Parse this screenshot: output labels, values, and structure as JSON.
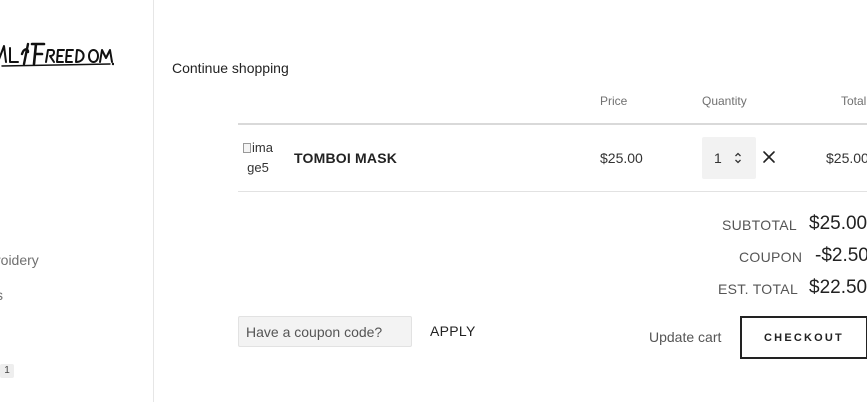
{
  "sidebar": {
    "logo_text": "RIDE IS FREEDOM",
    "nav_items": [
      {
        "label": "roidery"
      },
      {
        "label": "s"
      }
    ],
    "cart_count": "1"
  },
  "main": {
    "continue_label": "Continue shopping",
    "headers": {
      "price": "Price",
      "quantity": "Quantity",
      "total": "Total"
    },
    "items": [
      {
        "image_alt": "image5",
        "image_alt_line1": "ima",
        "image_alt_line2": "ge5",
        "name": "TOMBOI MASK",
        "price": "$25.00",
        "quantity": "1",
        "total": "$25.00"
      }
    ]
  },
  "summary": {
    "subtotal_label": "SUBTOTAL",
    "subtotal": "$25.00",
    "coupon_label": "COUPON",
    "coupon": "-$2.50",
    "est_total_label": "EST. TOTAL",
    "est_total": "$22.50"
  },
  "actions": {
    "coupon_placeholder": "Have a coupon code?",
    "coupon_value": "",
    "apply_label": "APPLY",
    "update_label": "Update cart",
    "checkout_label": "CHECKOUT"
  }
}
